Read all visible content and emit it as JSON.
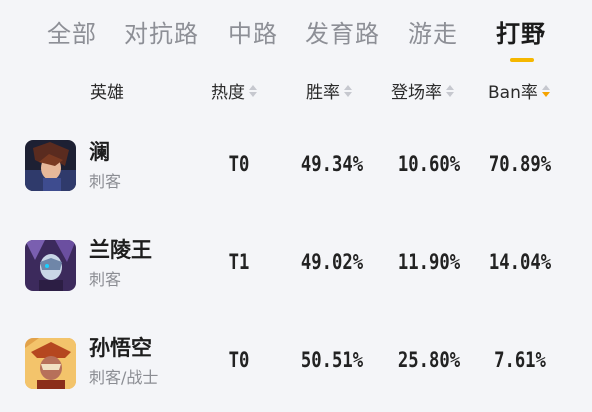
{
  "tabs": [
    {
      "label": "全部"
    },
    {
      "label": "对抗路"
    },
    {
      "label": "中路"
    },
    {
      "label": "发育路"
    },
    {
      "label": "游走"
    },
    {
      "label": "打野"
    }
  ],
  "active_tab": "打野",
  "accent_color": "#f5b700",
  "columns": {
    "hero": "英雄",
    "heat": "热度",
    "win_rate": "胜率",
    "pick_rate": "登场率",
    "ban_rate": "Ban率"
  },
  "sorted_by": "Ban率",
  "sort_direction": "descending",
  "rows": [
    {
      "name": "澜",
      "role": "刺客",
      "tier": "T0",
      "win_rate": "49.34%",
      "pick_rate": "10.60%",
      "ban_rate": "70.89%"
    },
    {
      "name": "兰陵王",
      "role": "刺客",
      "tier": "T1",
      "win_rate": "49.02%",
      "pick_rate": "11.90%",
      "ban_rate": "14.04%"
    },
    {
      "name": "孙悟空",
      "role": "刺客/战士",
      "tier": "T0",
      "win_rate": "50.51%",
      "pick_rate": "25.80%",
      "ban_rate": "7.61%"
    }
  ]
}
